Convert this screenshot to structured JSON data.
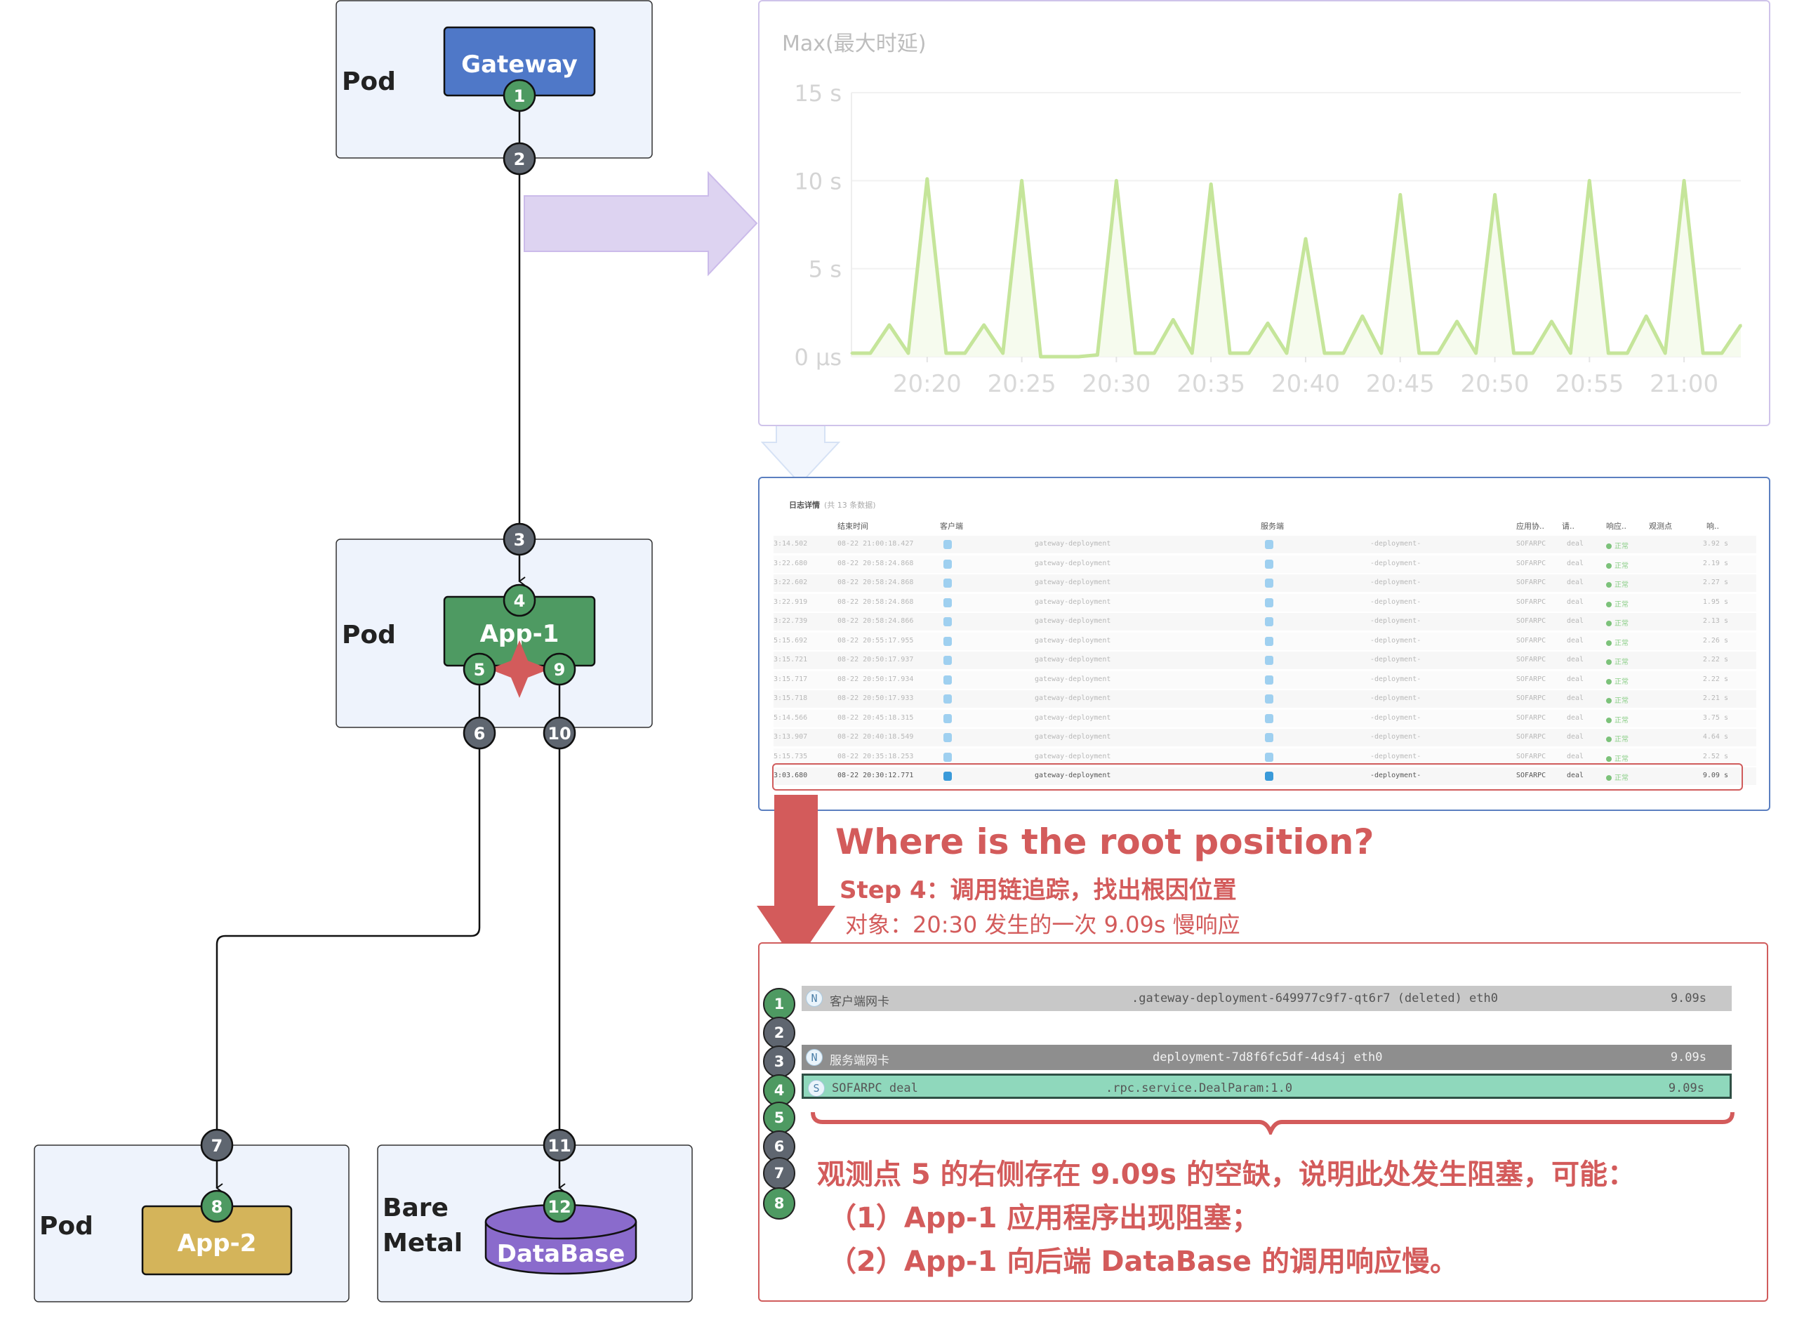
{
  "diagram": {
    "pod_label": "Pod",
    "bare_metal_label_1": "Bare",
    "bare_metal_label_2": "Metal",
    "gateway": "Gateway",
    "app1": "App-1",
    "app2": "App-2",
    "database": "DataBase",
    "points": [
      "1",
      "2",
      "3",
      "4",
      "5",
      "6",
      "7",
      "8",
      "9",
      "10",
      "11",
      "12"
    ],
    "colors": {
      "gateway": "#4f78c8",
      "app1": "#4e9a62",
      "app2": "#d4b45a",
      "database": "#8a6bcc",
      "observe_green": "#4e9a62",
      "observe_gray": "#5f6670",
      "pod_bg": "#eef3fc",
      "alert": "#d35b5b"
    }
  },
  "chart_data": {
    "type": "line",
    "title": "Max(最大时延)",
    "y_ticks": [
      "0 μs",
      "5 s",
      "10 s",
      "15 s"
    ],
    "ylim": [
      0,
      15
    ],
    "x_ticks": [
      "20:20",
      "20:25",
      "20:30",
      "20:35",
      "20:40",
      "20:45",
      "20:50",
      "20:55",
      "21:00"
    ],
    "x_start": "20:16",
    "x_step_minutes": 1,
    "grid": true,
    "color": "#c5e59a",
    "values": [
      0.2,
      0.2,
      1.8,
      0.2,
      10.1,
      0.2,
      0.2,
      1.8,
      0.2,
      10.0,
      0.0,
      0.0,
      0.0,
      0.1,
      10.0,
      0.2,
      0.2,
      2.1,
      0.2,
      9.8,
      0.2,
      0.2,
      1.9,
      0.2,
      6.7,
      0.2,
      0.2,
      2.3,
      0.2,
      9.2,
      0.2,
      0.2,
      2.0,
      0.2,
      9.2,
      0.2,
      0.2,
      2.0,
      0.2,
      10.0,
      0.2,
      0.2,
      2.3,
      0.2,
      10.0,
      0.2,
      0.2,
      1.8
    ]
  },
  "table": {
    "title": "日志详情",
    "count": "(共 13 条数据)",
    "headers": [
      "结束时间",
      "客户端",
      "服务端",
      "应用协..",
      "请..",
      "响应..",
      "观测点",
      "响.."
    ],
    "rows": [
      {
        "start": "3:14.502",
        "end": "08-22 21:00:18.427",
        "client": "gateway-deployment",
        "server": "-deployment-",
        "protocol": "SOFARPC",
        "request": "deal",
        "status": "正常",
        "duration": "3.92 s"
      },
      {
        "start": "3:22.680",
        "end": "08-22 20:58:24.868",
        "client": "gateway-deployment",
        "server": "-deployment-",
        "protocol": "SOFARPC",
        "request": "deal",
        "status": "正常",
        "duration": "2.19 s"
      },
      {
        "start": "3:22.602",
        "end": "08-22 20:58:24.868",
        "client": "gateway-deployment",
        "server": "-deployment-",
        "protocol": "SOFARPC",
        "request": "deal",
        "status": "正常",
        "duration": "2.27 s"
      },
      {
        "start": "3:22.919",
        "end": "08-22 20:58:24.868",
        "client": "gateway-deployment",
        "server": "-deployment-",
        "protocol": "SOFARPC",
        "request": "deal",
        "status": "正常",
        "duration": "1.95 s"
      },
      {
        "start": "3:22.739",
        "end": "08-22 20:58:24.866",
        "client": "gateway-deployment",
        "server": "-deployment-",
        "protocol": "SOFARPC",
        "request": "deal",
        "status": "正常",
        "duration": "2.13 s"
      },
      {
        "start": "5:15.692",
        "end": "08-22 20:55:17.955",
        "client": "gateway-deployment",
        "server": "-deployment-",
        "protocol": "SOFARPC",
        "request": "deal",
        "status": "正常",
        "duration": "2.26 s"
      },
      {
        "start": "3:15.721",
        "end": "08-22 20:50:17.937",
        "client": "gateway-deployment",
        "server": "-deployment-",
        "protocol": "SOFARPC",
        "request": "deal",
        "status": "正常",
        "duration": "2.22 s"
      },
      {
        "start": "3:15.717",
        "end": "08-22 20:50:17.934",
        "client": "gateway-deployment",
        "server": "-deployment-",
        "protocol": "SOFARPC",
        "request": "deal",
        "status": "正常",
        "duration": "2.22 s"
      },
      {
        "start": "3:15.718",
        "end": "08-22 20:50:17.933",
        "client": "gateway-deployment",
        "server": "-deployment-",
        "protocol": "SOFARPC",
        "request": "deal",
        "status": "正常",
        "duration": "2.21 s"
      },
      {
        "start": "5:14.566",
        "end": "08-22 20:45:18.315",
        "client": "gateway-deployment",
        "server": "-deployment-",
        "protocol": "SOFARPC",
        "request": "deal",
        "status": "正常",
        "duration": "3.75 s"
      },
      {
        "start": "3:13.907",
        "end": "08-22 20:40:18.549",
        "client": "gateway-deployment",
        "server": "-deployment-",
        "protocol": "SOFARPC",
        "request": "deal",
        "status": "正常",
        "duration": "4.64 s"
      },
      {
        "start": "5:15.735",
        "end": "08-22 20:35:18.253",
        "client": "gateway-deployment",
        "server": "-deployment-",
        "protocol": "SOFARPC",
        "request": "deal",
        "status": "正常",
        "duration": "2.52 s"
      },
      {
        "start": "3:03.680",
        "end": "08-22 20:30:12.771",
        "client": "gateway-deployment",
        "server": "-deployment-",
        "protocol": "SOFARPC",
        "request": "deal",
        "status": "正常",
        "duration": "9.09 s",
        "highlighted": true
      }
    ]
  },
  "annotation": {
    "heading": "Where is the root position?",
    "step": "Step 4：调用链追踪，找出根因位置",
    "target": "对象：20:30 发生的一次 9.09s 慢响应"
  },
  "trace": {
    "rows": [
      {
        "badge": "N",
        "name": "客户端网卡",
        "resource": ".gateway-deployment-649977c9f7-qt6r7 (deleted) eth0",
        "duration": "9.09s",
        "color": "#c8c8c8"
      },
      {
        "badge": "N",
        "name": "服务端网卡",
        "resource": "deployment-7d8f6fc5df-4ds4j eth0",
        "duration": "9.09s",
        "color": "#8e8e8e"
      },
      {
        "badge": "S",
        "name": "SOFARPC deal",
        "resource": ".rpc.service.DealParam:1.0",
        "duration": "9.09s",
        "color": "#8fd8bc"
      }
    ],
    "observation_points": [
      "1",
      "2",
      "3",
      "4",
      "5",
      "6",
      "7",
      "8"
    ],
    "conclusion": "观测点 5 的右侧存在 9.09s 的空缺，说明此处发生阻塞，可能：",
    "reason_1": "（1）App-1 应用程序出现阻塞；",
    "reason_2": "（2）App-1 向后端 DataBase 的调用响应慢。"
  }
}
